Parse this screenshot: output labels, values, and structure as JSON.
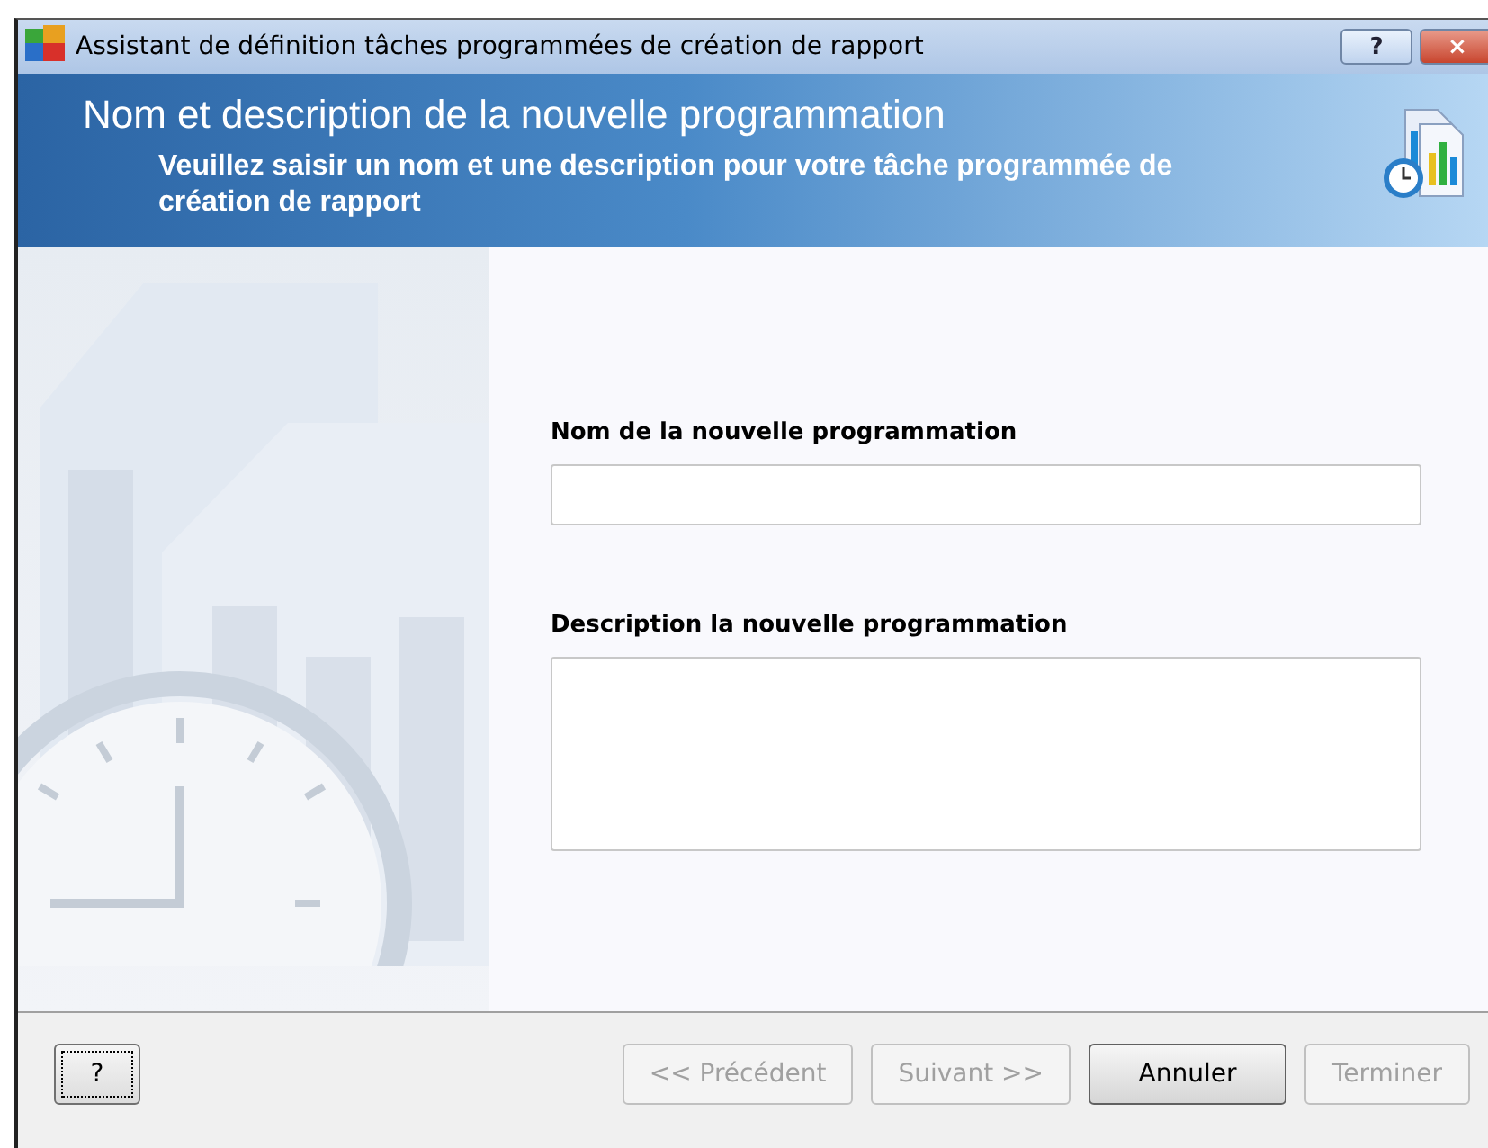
{
  "window": {
    "title": "Assistant de définition tâches programmées de création de rapport",
    "controls": [
      "?",
      "×"
    ]
  },
  "header": {
    "title": "Nom et description de la nouvelle programmation",
    "subtitle": "Veuillez saisir un nom et une description pour votre tâche programmée de création de rapport"
  },
  "form": {
    "fields": [
      {
        "label": "Nom de la nouvelle programmation",
        "kind": "line"
      },
      {
        "label": "Description la nouvelle programmation",
        "kind": "area"
      }
    ]
  },
  "footer": {
    "help": {
      "label": "?",
      "focused": true
    },
    "buttons": [
      {
        "label": "<< Précédent",
        "disabled": true
      },
      {
        "label": "Suivant >>",
        "disabled": true
      },
      {
        "label": "Annuler",
        "disabled": false
      },
      {
        "label": "Terminer",
        "disabled": true
      }
    ]
  }
}
